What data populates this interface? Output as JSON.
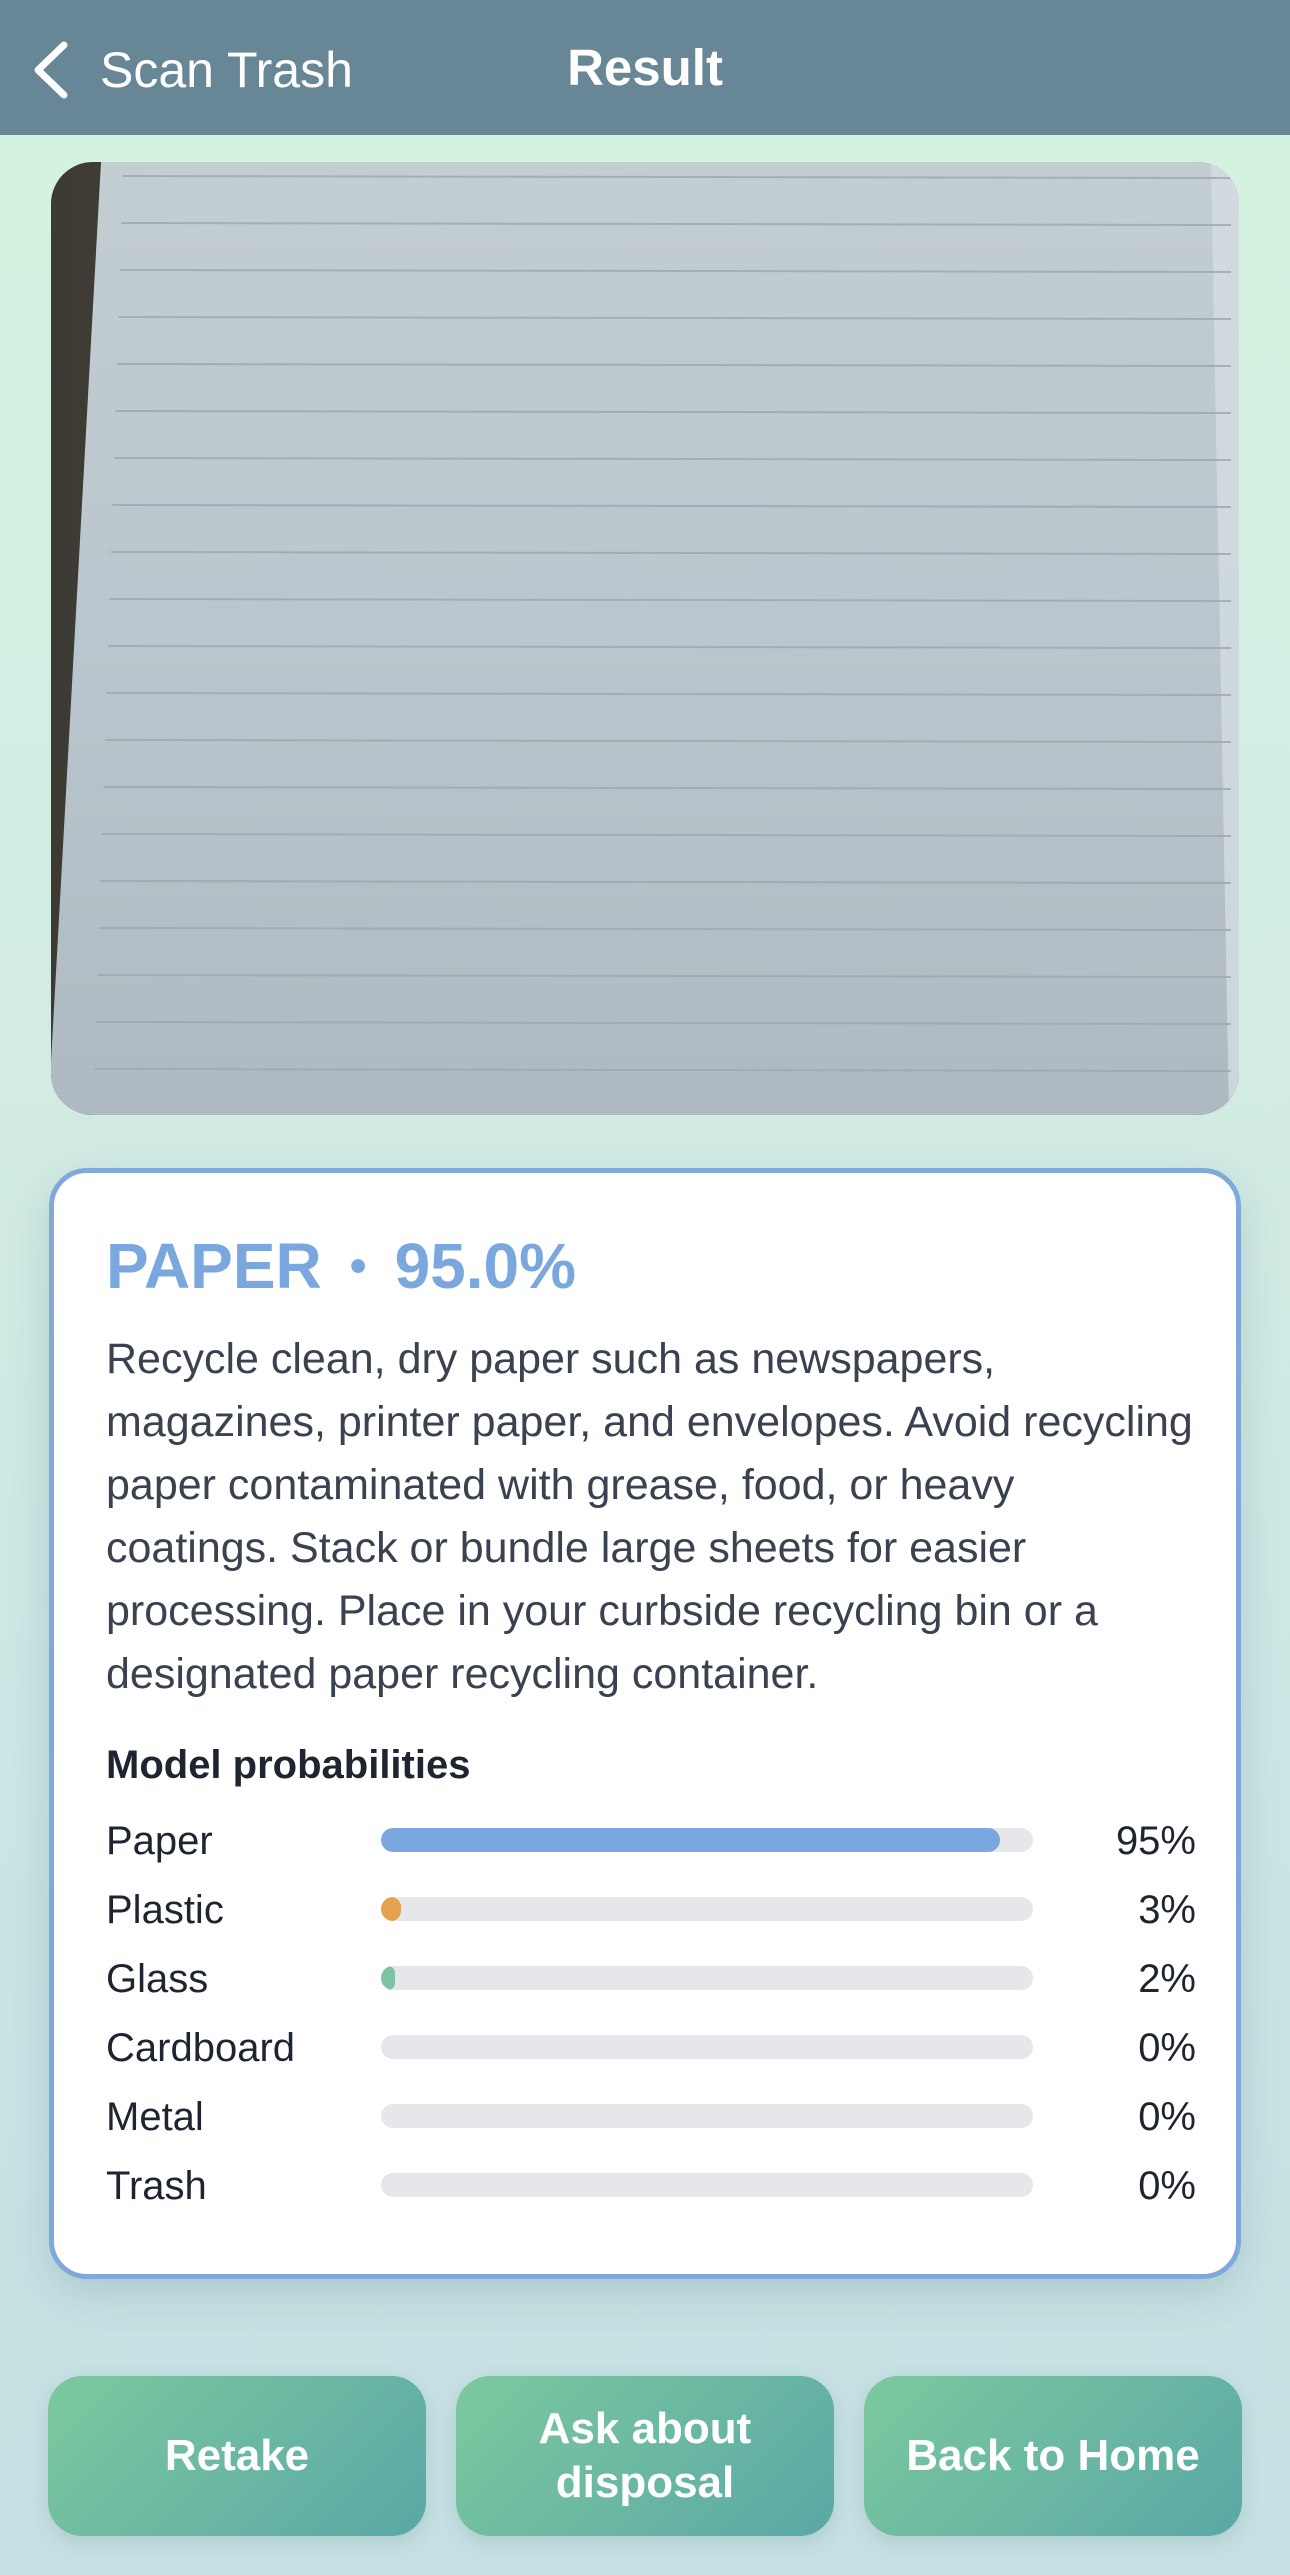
{
  "navbar": {
    "back_label": "Scan Trash",
    "title": "Result"
  },
  "photo": {
    "description_icon": "lined-paper-photo"
  },
  "result": {
    "category": "PAPER",
    "separator": "•",
    "confidence": "95.0%",
    "description": "Recycle clean, dry paper such as newspapers, magazines, printer paper, and envelopes. Avoid recycling paper contaminated with grease, food, or heavy coatings. Stack or bundle large sheets for easier processing. Place in your curbside recycling bin or a designated paper recycling container.",
    "probabilities_title": "Model probabilities",
    "probabilities": [
      {
        "label": "Paper",
        "value": "95%",
        "fraction": 0.95,
        "color": "#79a7de"
      },
      {
        "label": "Plastic",
        "value": "3%",
        "fraction": 0.03,
        "color": "#e5a24e"
      },
      {
        "label": "Glass",
        "value": "2%",
        "fraction": 0.02,
        "color": "#7cc3a1"
      },
      {
        "label": "Cardboard",
        "value": "0%",
        "fraction": 0,
        "color": "#a9835d"
      },
      {
        "label": "Metal",
        "value": "0%",
        "fraction": 0,
        "color": "#9aa3ad"
      },
      {
        "label": "Trash",
        "value": "0%",
        "fraction": 0,
        "color": "#6c6f75"
      }
    ]
  },
  "actions": {
    "retake_label": "Retake",
    "ask_label": "Ask about disposal",
    "home_label": "Back to Home"
  },
  "colors": {
    "navbar": "#678797",
    "accent": "#79a7de",
    "button_gradient_start": "#7cc99e",
    "button_gradient_end": "#5aa8a6"
  }
}
